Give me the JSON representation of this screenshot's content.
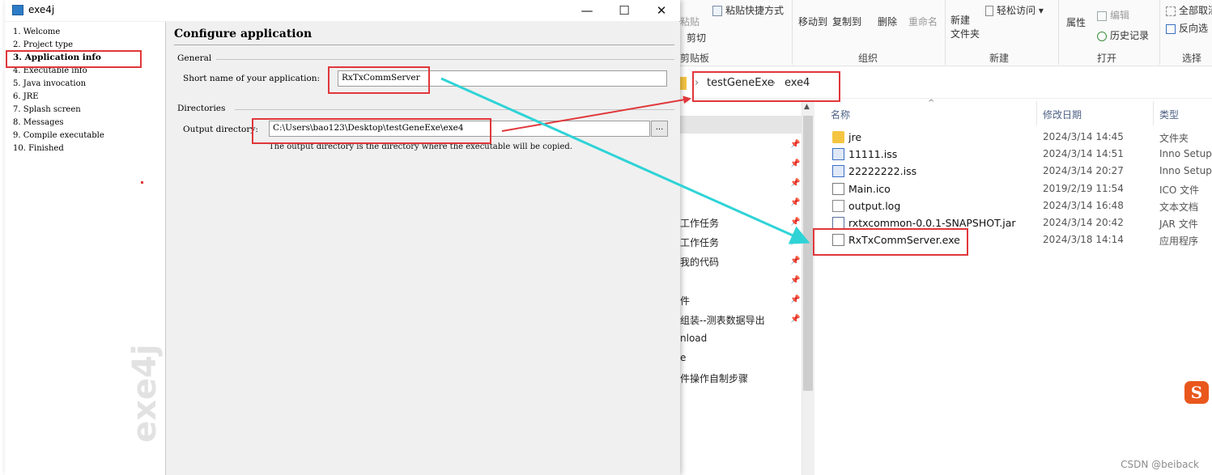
{
  "explorer": {
    "ribbon": {
      "items": [
        "粘贴",
        "粘贴快捷方式",
        "剪切",
        "移动到",
        "复制到",
        "删除",
        "重命名",
        "新建\n文件夹",
        "轻松访问",
        "属性",
        "编辑",
        "历史记录",
        "全部取消",
        "反向选"
      ],
      "groups": [
        "剪贴板",
        "组织",
        "新建",
        "打开",
        "选择"
      ]
    },
    "breadcrumb": [
      "testGeneExe",
      "exe4"
    ],
    "nav_items": [
      "",
      "工作任务",
      "工作任务",
      "我的代码",
      "件",
      "组装--测表数据导出",
      "nload",
      "e",
      "件操作自制步骤"
    ],
    "columns": {
      "name": "名称",
      "date": "修改日期",
      "type": "类型"
    },
    "files": [
      {
        "name": "jre",
        "date": "2024/3/14 14:45",
        "type": "文件夹",
        "icon": "folder-icon"
      },
      {
        "name": "11111.iss",
        "date": "2024/3/14 14:51",
        "type": "Inno Setup",
        "icon": "iss-file-icon"
      },
      {
        "name": "22222222.iss",
        "date": "2024/3/14 20:27",
        "type": "Inno Setup",
        "icon": "iss-file-icon"
      },
      {
        "name": "Main.ico",
        "date": "2019/2/19 11:54",
        "type": "ICO 文件",
        "icon": "ico-file-icon"
      },
      {
        "name": "output.log",
        "date": "2024/3/14 16:48",
        "type": "文本文档",
        "icon": "text-file-icon"
      },
      {
        "name": "rxtxcommon-0.0.1-SNAPSHOT.jar",
        "date": "2024/3/14 20:42",
        "type": "JAR 文件",
        "icon": "jar-file-icon"
      },
      {
        "name": "RxTxCommServer.exe",
        "date": "2024/3/18 14:14",
        "type": "应用程序",
        "icon": "exe-file-icon"
      }
    ],
    "watermark": "CSDN @beiback",
    "sogou_glyph": "S"
  },
  "window": {
    "title": "exe4j",
    "controls": {
      "minimize": "—",
      "maximize": "☐",
      "close": "✕"
    },
    "steps": [
      "1.  Welcome",
      "2.  Project type",
      "3.  Application info",
      "4.  Executable info",
      "5.  Java invocation",
      "6.  JRE",
      "7.  Splash screen",
      "8.  Messages",
      "9.  Compile executable",
      "10.  Finished"
    ],
    "active_step": 2,
    "sidebar_watermark": "exe4j",
    "section_title": "Configure application",
    "general": {
      "heading": "General",
      "short_name_label": "Short name of your application:",
      "short_name_value": "RxTxCommServer"
    },
    "directories": {
      "heading": "Directories",
      "output_label": "Output directory:",
      "output_value": "C:\\Users\\bao123\\Desktop\\testGeneExe\\exe4",
      "browse_label": "...",
      "hint": "The output directory is the directory where the executable will be copied."
    }
  },
  "colors": {
    "annotation_red": "#e0373b",
    "annotation_cyan": "#2fd3d6"
  }
}
